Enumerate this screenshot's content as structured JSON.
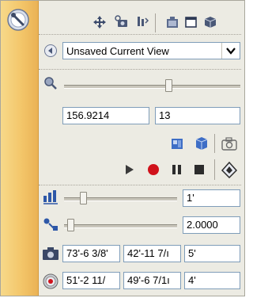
{
  "view": {
    "current_view": "Unsaved Current View"
  },
  "zoom": {
    "slider_fraction": 0.6,
    "value_a": "156.9214",
    "value_b": "13"
  },
  "step": {
    "slider_fraction": 0.15,
    "value": "1'"
  },
  "speed": {
    "slider_fraction": 0.03,
    "value": "2.0000"
  },
  "camera": {
    "x": "73'-6 3/8'",
    "y": "42'-11 7/ı",
    "z": "5'"
  },
  "target": {
    "x": "51'-2 11/",
    "y": "49'-6 7/1ı",
    "z": "4'"
  },
  "colors": {
    "accent_strip": "#f3c66a",
    "record": "#d0121b"
  }
}
